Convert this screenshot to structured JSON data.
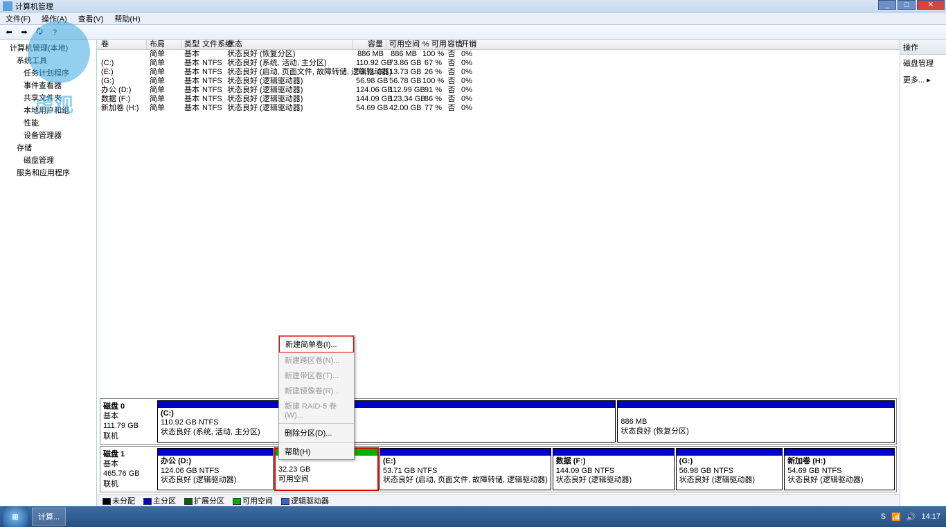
{
  "title": "计算机管理",
  "menu": {
    "file": "文件(F)",
    "action": "操作(A)",
    "view": "查看(V)",
    "help": "帮助(H)"
  },
  "tree": {
    "root": "计算机管理(本地)",
    "sys_tools": "系统工具",
    "task": "任务计划程序",
    "event": "事件查看器",
    "shared": "共享文件夹",
    "local_users": "本地用户和组",
    "perf": "性能",
    "dev": "设备管理器",
    "storage": "存储",
    "diskmgmt": "磁盘管理",
    "services": "服务和应用程序"
  },
  "vol_header": {
    "vol": "卷",
    "layout": "布局",
    "type": "类型",
    "fs": "文件系统",
    "status": "状态",
    "cap": "容量",
    "free": "可用空间",
    "pct": "% 可用",
    "err": "容错",
    "ovh": "开销"
  },
  "volumes": [
    {
      "vol": "",
      "layout": "简单",
      "type": "基本",
      "fs": "",
      "status": "状态良好 (恢复分区)",
      "cap": "886 MB",
      "free": "886 MB",
      "pct": "100 %",
      "err": "否",
      "ovh": "0%"
    },
    {
      "vol": "(C:)",
      "layout": "简单",
      "type": "基本",
      "fs": "NTFS",
      "status": "状态良好 (系统, 活动, 主分区)",
      "cap": "110.92 GB",
      "free": "73.86 GB",
      "pct": "67 %",
      "err": "否",
      "ovh": "0%"
    },
    {
      "vol": "(E:)",
      "layout": "简单",
      "type": "基本",
      "fs": "NTFS",
      "status": "状态良好 (启动, 页面文件, 故障转储, 逻辑驱动器)",
      "cap": "53.71 GB",
      "free": "13.73 GB",
      "pct": "26 %",
      "err": "否",
      "ovh": "0%"
    },
    {
      "vol": "(G:)",
      "layout": "简单",
      "type": "基本",
      "fs": "NTFS",
      "status": "状态良好 (逻辑驱动器)",
      "cap": "56.98 GB",
      "free": "56.78 GB",
      "pct": "100 %",
      "err": "否",
      "ovh": "0%"
    },
    {
      "vol": "办公 (D:)",
      "layout": "简单",
      "type": "基本",
      "fs": "NTFS",
      "status": "状态良好 (逻辑驱动器)",
      "cap": "124.06 GB",
      "free": "112.99 GB",
      "pct": "91 %",
      "err": "否",
      "ovh": "0%"
    },
    {
      "vol": "数据 (F:)",
      "layout": "简单",
      "type": "基本",
      "fs": "NTFS",
      "status": "状态良好 (逻辑驱动器)",
      "cap": "144.09 GB",
      "free": "123.34 GB",
      "pct": "86 %",
      "err": "否",
      "ovh": "0%"
    },
    {
      "vol": "新加卷 (H:)",
      "layout": "简单",
      "type": "基本",
      "fs": "NTFS",
      "status": "状态良好 (逻辑驱动器)",
      "cap": "54.69 GB",
      "free": "42.00 GB",
      "pct": "77 %",
      "err": "否",
      "ovh": "0%"
    }
  ],
  "disk0": {
    "name": "磁盘 0",
    "type": "基本",
    "size": "111.79 GB",
    "state": "联机",
    "p1": {
      "title": "(C:)",
      "size": "110.92 GB NTFS",
      "status": "状态良好 (系统, 活动, 主分区)"
    },
    "p2": {
      "title": "",
      "size": "886 MB",
      "status": "状态良好 (恢复分区)"
    }
  },
  "disk1": {
    "name": "磁盘 1",
    "type": "基本",
    "size": "465.76 GB",
    "state": "联机",
    "pd": {
      "title": "办公  (D:)",
      "size": "124.06 GB NTFS",
      "status": "状态良好 (逻辑驱动器)"
    },
    "pu": {
      "title": "",
      "size": "32.23 GB",
      "status": "可用空间"
    },
    "pe": {
      "title": "(E:)",
      "size": "53.71 GB NTFS",
      "status": "状态良好 (启动, 页面文件, 故障转储, 逻辑驱动器)"
    },
    "pf": {
      "title": "数据  (F:)",
      "size": "144.09 GB NTFS",
      "status": "状态良好 (逻辑驱动器)"
    },
    "pg": {
      "title": "(G:)",
      "size": "56.98 GB NTFS",
      "status": "状态良好 (逻辑驱动器)"
    },
    "ph": {
      "title": "新加卷 (H:)",
      "size": "54.69 GB NTFS",
      "status": "状态良好 (逻辑驱动器)"
    }
  },
  "ctx": {
    "simple": "新建简单卷(I)...",
    "spanned": "新建跨区卷(N)...",
    "striped": "新建带区卷(T)...",
    "mirrored": "新建镜像卷(R)...",
    "raid5": "新建 RAID-5 卷(W)...",
    "delete": "删除分区(D)...",
    "help": "帮助(H)"
  },
  "legend": {
    "unalloc": "未分配",
    "primary": "主分区",
    "extended": "扩展分区",
    "free": "可用空间",
    "logical": "逻辑驱动器"
  },
  "right": {
    "header": "操作",
    "item1": "磁盘管理",
    "more": "更多..."
  },
  "taskbar": {
    "app": "计算...",
    "time": "14:17"
  },
  "watermark": "虎观"
}
